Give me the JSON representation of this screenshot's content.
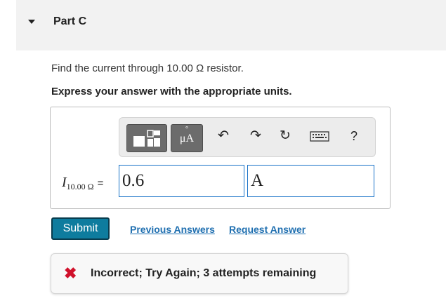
{
  "part": {
    "title": "Part C"
  },
  "question": {
    "text": "Find the current through 10.00 Ω resistor.",
    "instruction": "Express your answer with the appropriate units."
  },
  "toolbar": {
    "buttons": [
      {
        "name": "templates",
        "icon": "templates-icon"
      },
      {
        "name": "units",
        "label_top": "°",
        "label": "μA",
        "icon": "units-icon"
      },
      {
        "name": "undo",
        "icon": "undo-icon",
        "glyph": "↶"
      },
      {
        "name": "redo",
        "icon": "redo-icon",
        "glyph": "↷"
      },
      {
        "name": "reset",
        "icon": "reset-icon",
        "glyph": "↻"
      },
      {
        "name": "keyboard",
        "icon": "keyboard-icon"
      },
      {
        "name": "help",
        "icon": "help-icon",
        "glyph": "?"
      }
    ]
  },
  "answer": {
    "variable": "I",
    "subscript": "10.00 Ω",
    "equals": "=",
    "value": "0.6",
    "unit": "A"
  },
  "actions": {
    "submit_label": "Submit",
    "previous_answers_label": "Previous Answers",
    "request_answer_label": "Request Answer"
  },
  "feedback": {
    "icon": "x-icon",
    "text": "Incorrect; Try Again; 3 attempts remaining",
    "color": "#d0112b"
  },
  "colors": {
    "submit_bg": "#0e7c9e",
    "link": "#1f6fb0",
    "field_border": "#1a73c8"
  }
}
